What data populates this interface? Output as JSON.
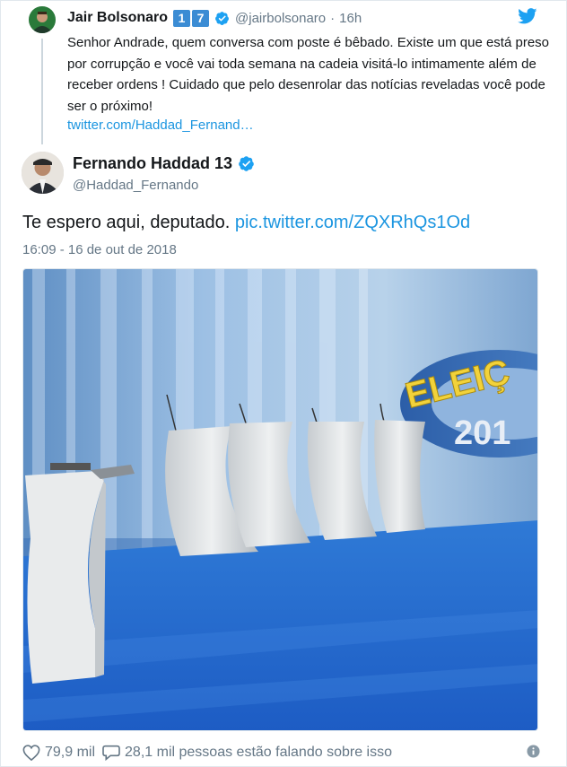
{
  "parent_tweet": {
    "author_name": "Jair Bolsonaro",
    "badge_digits": [
      "1",
      "7"
    ],
    "handle": "@jairbolsonaro",
    "separator": "·",
    "time": "16h",
    "text": "Senhor Andrade, quem conversa com poste é bêbado. Existe um que está preso por corrupção e você vai toda semana na cadeia visitá-lo intimamente além de receber ordens ! Cuidado que pelo desenrolar das notícias reveladas você pode ser o próximo!",
    "link": "twitter.com/Haddad_Fernand…",
    "verified_icon": "verified-badge-icon"
  },
  "main_tweet": {
    "author_name": "Fernando Haddad 13",
    "handle": "@Haddad_Fernando",
    "text": "Te espero aqui, deputado.",
    "link": "pic.twitter.com/ZQXRhQs1Od",
    "timestamp": "16:09 - 16 de out de 2018",
    "media_text": {
      "banner_word": "ELEIÇ",
      "banner_year": "201"
    }
  },
  "footer": {
    "likes": "79,9 mil",
    "talk": "28,1 mil pessoas estão falando sobre isso",
    "like_icon": "heart-icon",
    "reply_icon": "speech-bubble-icon",
    "info_icon": "info-icon"
  },
  "colors": {
    "link": "#1b95e0",
    "secondary_text": "#657786",
    "verified": "#1da1f2",
    "badge": "#3b8cd4",
    "twitter_bird": "#1da1f2"
  }
}
